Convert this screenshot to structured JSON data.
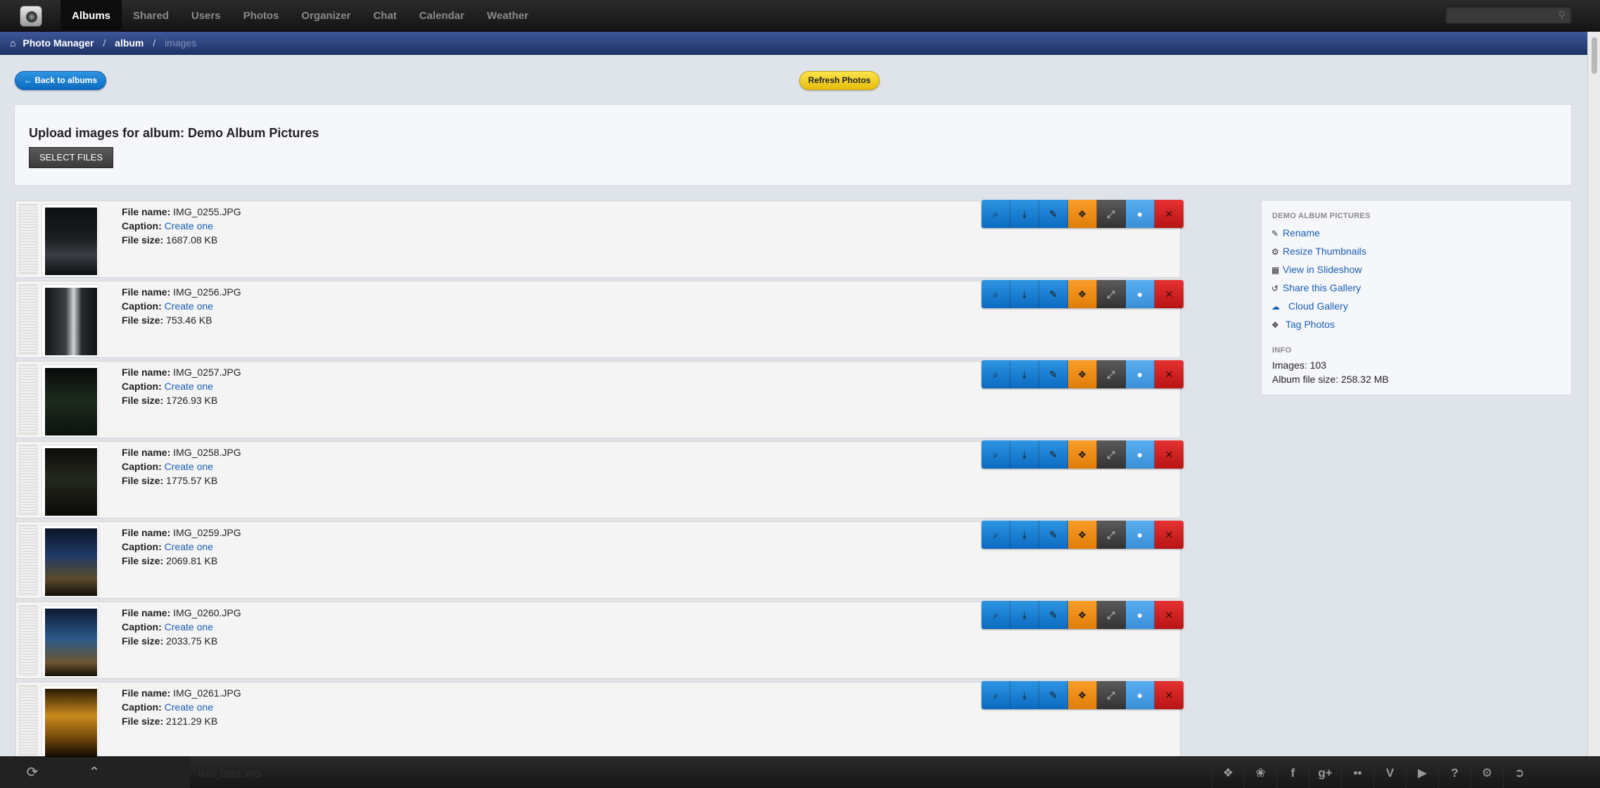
{
  "nav": {
    "tabs": [
      "Albums",
      "Shared",
      "Users",
      "Photos",
      "Organizer",
      "Chat",
      "Calendar",
      "Weather"
    ],
    "active": "Albums",
    "search_placeholder": ""
  },
  "breadcrumb": {
    "home": "Photo Manager",
    "album": "album",
    "current": "images"
  },
  "actions": {
    "back_label": "← Back to albums",
    "refresh_label": "Refresh Photos"
  },
  "upload": {
    "title": "Upload images for album: Demo Album Pictures",
    "select_label": "SELECT FILES"
  },
  "labels": {
    "file_name": "File name:",
    "caption": "Caption:",
    "file_size": "File size:",
    "caption_link": "Create one"
  },
  "images": [
    {
      "file_name": "IMG_0255.JPG",
      "file_size": "1687.08 KB"
    },
    {
      "file_name": "IMG_0256.JPG",
      "file_size": "753.46 KB"
    },
    {
      "file_name": "IMG_0257.JPG",
      "file_size": "1726.93 KB"
    },
    {
      "file_name": "IMG_0258.JPG",
      "file_size": "1775.57 KB"
    },
    {
      "file_name": "IMG_0259.JPG",
      "file_size": "2069.81 KB"
    },
    {
      "file_name": "IMG_0260.JPG",
      "file_size": "2033.75 KB"
    },
    {
      "file_name": "IMG_0261.JPG",
      "file_size": "2121.29 KB"
    }
  ],
  "row_tools": [
    "zoom-icon",
    "download-icon",
    "edit-icon",
    "tag-icon",
    "expand-icon",
    "circle-icon",
    "close-icon"
  ],
  "sidebar": {
    "album_heading": "DEMO ALBUM PICTURES",
    "links": [
      {
        "label": "Rename",
        "icon": "pencil-icon"
      },
      {
        "label": "Resize Thumbnails",
        "icon": "gear-icon"
      },
      {
        "label": "View in Slideshow",
        "icon": "picture-icon"
      },
      {
        "label": "Share this Gallery",
        "icon": "share-icon"
      },
      {
        "label": "Cloud Gallery",
        "icon": "cloud-icon"
      },
      {
        "label": "Tag Photos",
        "icon": "tag-icon"
      }
    ],
    "info_heading": "INFO",
    "images_count": "Images: 103",
    "album_size": "Album file size: 258.32 MB"
  },
  "bottom": {
    "peek_text": "IMG_0262.JPG",
    "social_icons": [
      "dropbox-icon",
      "twitter-icon",
      "facebook-icon",
      "google-plus-icon",
      "flickr-icon",
      "vimeo-icon",
      "youtube-icon",
      "help-icon",
      "settings-icon",
      "logout-icon"
    ]
  },
  "colors": {
    "accent_blue": "#0d6bbf",
    "refresh_yellow": "#f2cd1d",
    "tool_orange": "#f08c14",
    "tool_red": "#d21f1f",
    "breadcrumb_blue": "#2c4380"
  }
}
